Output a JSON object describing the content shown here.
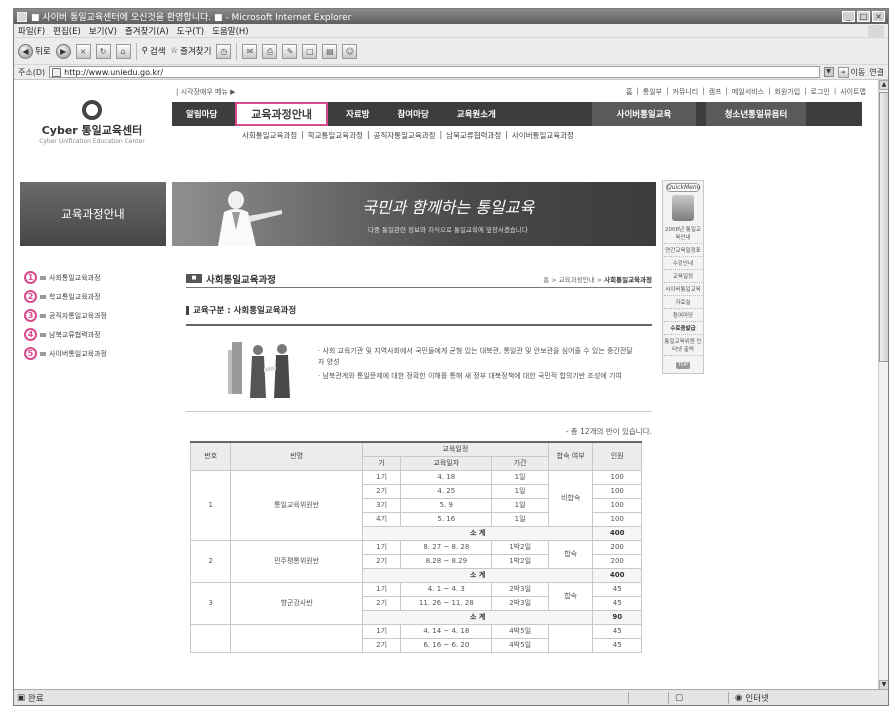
{
  "window": {
    "title": "■ 사이버 통일교육센터에 오신것을 환영합니다. ■ - Microsoft Internet Explorer",
    "controls": [
      "_",
      "□",
      "×"
    ]
  },
  "menubar": [
    "파일(F)",
    "편집(E)",
    "보기(V)",
    "즐겨찾기(A)",
    "도구(T)",
    "도움말(H)"
  ],
  "toolbar": {
    "back": "뒤로",
    "search": "검색",
    "favorites": "즐겨찾기"
  },
  "address": {
    "label": "주소(D)",
    "url": "http://www.uniedu.go.kr/",
    "go": "이동",
    "links": "연결"
  },
  "header": {
    "logo_name": "Cyber 통일교육센터",
    "logo_sub": "Cyber Unification Education Center",
    "util_left": "| 시각장애우 메뉴 ▶",
    "util_links": [
      "홈",
      "통일부",
      "커뮤니티",
      "캠프",
      "메일서비스",
      "회원가입",
      "로그인",
      "사이트맵"
    ],
    "gnb": [
      "알림마당",
      "교육과정안내",
      "자료방",
      "참여마당",
      "교육원소개"
    ],
    "gnb_right": [
      "사이버통일교육",
      "청소년통일뮤음터"
    ],
    "subnav": [
      "사회통일교육과정",
      "학교통일교육과정",
      "공직자통일교육과정",
      "남북교류협력과정",
      "사이버통일교육과정"
    ]
  },
  "sidebar": {
    "title": "교육과정안내",
    "items": [
      {
        "num": "1",
        "label": "사회통일교육과정"
      },
      {
        "num": "2",
        "label": "학교통일교육과정"
      },
      {
        "num": "3",
        "label": "공직자통일교육과정"
      },
      {
        "num": "4",
        "label": "남북교류협력과정"
      },
      {
        "num": "5",
        "label": "사이버통일교육과정"
      }
    ]
  },
  "banner": {
    "slogan": "국민과 함께하는 통일교육",
    "sub": "다중 통일관련 정보와 지식으로 통일교육에 앞장서겠습니다"
  },
  "quickmenu": {
    "head": "QuickMenu",
    "items": [
      "2008년 통일교육안내",
      "연간교육일정표",
      "수강안내",
      "교육일정",
      "사이버통일교육",
      "자료실",
      "참여마당",
      "수료증발급",
      "통일교육위원 인터넷 출력"
    ],
    "top": "TOP"
  },
  "content": {
    "title": "사회통일교육과정",
    "breadcrumb_pre": "홈 > 교육과정안내 > ",
    "breadcrumb_current": "사회통일교육과정",
    "section": "교육구분 : 사회통일교육과정",
    "bullets": [
      "· 사회 교육기관 및 지역사회에서 국민들에게 균형 있는 대북관, 통일관 및 안보관을 심어줄 수 있는 중간전달자 양성",
      "· 남북관계와 통일문제에 대한 정확한 이해를 통해 새 정부 대북정책에 대한 국민적 합의기반 조성에 기여"
    ],
    "count_note": "- 총 12개의 반이 있습니다."
  },
  "table": {
    "headers": {
      "no": "번호",
      "class": "반명",
      "schedule": "교육일정",
      "term": "기",
      "dates": "교육일자",
      "period": "기간",
      "lodging": "합숙 여부",
      "quota": "인원"
    },
    "subtotal_label": "소 계",
    "groups": [
      {
        "no": "1",
        "name": "통일교육위원반",
        "lodging": "비합숙",
        "rows": [
          {
            "term": "1기",
            "dates": "4. 18",
            "period": "1일",
            "quota": "100"
          },
          {
            "term": "2기",
            "dates": "4. 25",
            "period": "1일",
            "quota": "100"
          },
          {
            "term": "3기",
            "dates": "5. 9",
            "period": "1일",
            "quota": "100"
          },
          {
            "term": "4기",
            "dates": "5. 16",
            "period": "1일",
            "quota": "100"
          }
        ],
        "subtotal": "400"
      },
      {
        "no": "2",
        "name": "민주평통위원반",
        "lodging": "합숙",
        "rows": [
          {
            "term": "1기",
            "dates": "8. 27 ~ 8. 28",
            "period": "1박2일",
            "quota": "200"
          },
          {
            "term": "2기",
            "dates": "8.28 ~ 8.29",
            "period": "1박2일",
            "quota": "200"
          }
        ],
        "subtotal": "400"
      },
      {
        "no": "3",
        "name": "향군강사반",
        "lodging": "합숙",
        "rows": [
          {
            "term": "1기",
            "dates": "4. 1 ~ 4. 3",
            "period": "2박3일",
            "quota": "45"
          },
          {
            "term": "2기",
            "dates": "11. 26 ~ 11. 28",
            "period": "2박3일",
            "quota": "45"
          }
        ],
        "subtotal": "90"
      },
      {
        "no": "",
        "name": "",
        "lodging": "",
        "rows": [
          {
            "term": "1기",
            "dates": "4. 14 ~ 4. 18",
            "period": "4박5일",
            "quota": "45"
          },
          {
            "term": "2기",
            "dates": "6. 16 ~ 6. 20",
            "period": "4박5일",
            "quota": "45"
          }
        ],
        "subtotal": null
      }
    ]
  },
  "status": {
    "done": "완료",
    "zone": "인터넷"
  },
  "colors": {
    "accent": "#d94a8c",
    "nav": "#3d3d3d"
  }
}
